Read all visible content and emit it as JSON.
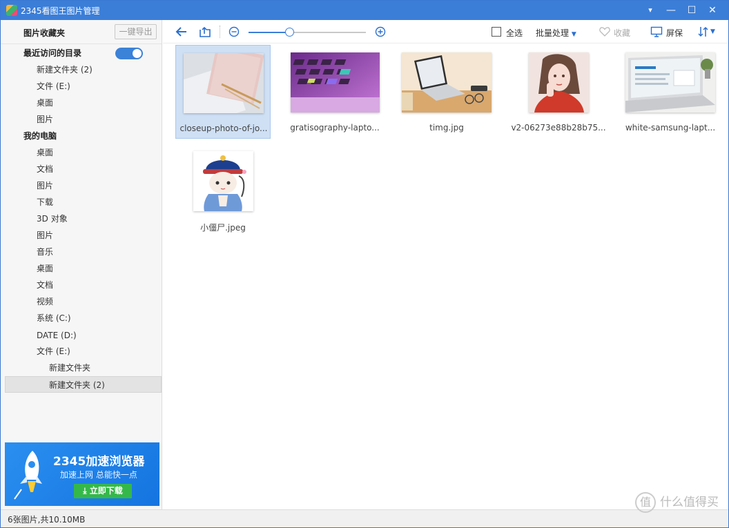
{
  "window": {
    "title": "2345看图王图片管理",
    "controls": [
      "▾",
      "—",
      "☐",
      "✕"
    ]
  },
  "sidebar": {
    "favorites_title": "图片收藏夹",
    "export_label": "一键导出",
    "recent_title": "最近访问的目录",
    "recent_items": [
      "新建文件夹 (2)",
      "文件 (E:)",
      "桌面",
      "图片"
    ],
    "computer_title": "我的电脑",
    "computer_items": [
      "桌面",
      "文档",
      "图片",
      "下载",
      "3D 对象",
      "图片",
      "音乐",
      "桌面",
      "文档",
      "视频",
      "系统 (C:)",
      "DATE (D:)",
      "文件 (E:)"
    ],
    "sub_items": [
      "新建文件夹",
      "新建文件夹 (2)"
    ]
  },
  "ad": {
    "title": "2345加速浏览器",
    "subtitle": "加速上网 总能快一点",
    "button": "立即下载"
  },
  "toolbar": {
    "select_all": "全选",
    "batch": "批量处理",
    "favorite": "收藏",
    "screen": "屏保",
    "zoom_level": 0.35
  },
  "images": [
    {
      "name": "closeup-photo-of-jo...",
      "selected": true
    },
    {
      "name": "gratisography-lapto..."
    },
    {
      "name": "timg.jpg"
    },
    {
      "name": "v2-06273e88b28b75..."
    },
    {
      "name": "white-samsung-lapt..."
    },
    {
      "name": "小僵尸.jpeg"
    }
  ],
  "status": {
    "summary": "6张图片,共10.10MB"
  },
  "watermark": {
    "text": "什么值得买",
    "logo_glyph": "值"
  },
  "colors": {
    "titlebar": "#3b7ed8",
    "accent": "#3b82d9",
    "selection": "#cfe0f5"
  }
}
